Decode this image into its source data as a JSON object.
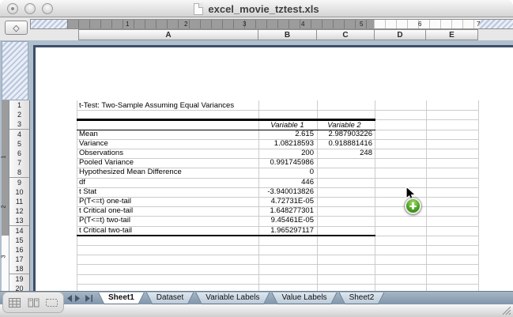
{
  "window": {
    "title": "excel_movie_tztest.xls"
  },
  "toolbar": {
    "corner_button_glyph": "◇"
  },
  "ruler": {
    "horizontal_numbers": [
      "1",
      "2",
      "3",
      "4",
      "5",
      "6",
      "7"
    ],
    "vertical_numbers": [
      "1",
      "2",
      "3"
    ]
  },
  "sheet": {
    "columns": [
      "A",
      "B",
      "C",
      "D",
      "E"
    ],
    "rows": [
      "1",
      "2",
      "3",
      "4",
      "5",
      "6",
      "7",
      "8",
      "9",
      "10",
      "11",
      "12",
      "13",
      "14",
      "15",
      "16",
      "17",
      "18",
      "19",
      "20"
    ]
  },
  "table": {
    "title": "t-Test: Two-Sample Assuming Equal Variances",
    "col_headers": [
      "Variable 1",
      "Variable 2"
    ],
    "rows": [
      {
        "label": "Mean",
        "v1": "2.615",
        "v2": "2.987903226"
      },
      {
        "label": "Variance",
        "v1": "1.08218593",
        "v2": "0.918881416"
      },
      {
        "label": "Observations",
        "v1": "200",
        "v2": "248"
      },
      {
        "label": "Pooled Variance",
        "v1": "0.991745986",
        "v2": ""
      },
      {
        "label": "Hypothesized Mean Difference",
        "v1": "0",
        "v2": ""
      },
      {
        "label": "df",
        "v1": "446",
        "v2": ""
      },
      {
        "label": "t Stat",
        "v1": "-3.940013826",
        "v2": ""
      },
      {
        "label": "P(T<=t) one-tail",
        "v1": "4.72731E-05",
        "v2": ""
      },
      {
        "label": "t Critical one-tail",
        "v1": "1.648277301",
        "v2": ""
      },
      {
        "label": "P(T<=t) two-tail",
        "v1": "9.45461E-05",
        "v2": ""
      },
      {
        "label": "t Critical two-tail",
        "v1": "1.965297117",
        "v2": ""
      }
    ]
  },
  "sheet_tabs": [
    {
      "label": "Sheet1",
      "active": true
    },
    {
      "label": "Dataset",
      "active": false
    },
    {
      "label": "Variable Labels",
      "active": false
    },
    {
      "label": "Value Labels",
      "active": false
    },
    {
      "label": "Sheet2",
      "active": false
    }
  ],
  "cursor": {
    "badge_glyph": "+",
    "badge_color": "#4aa41f"
  },
  "colors": {
    "tab_bar": "#8fa3b6",
    "page_border": "#3d4e68",
    "grid_line": "#cccccc"
  }
}
